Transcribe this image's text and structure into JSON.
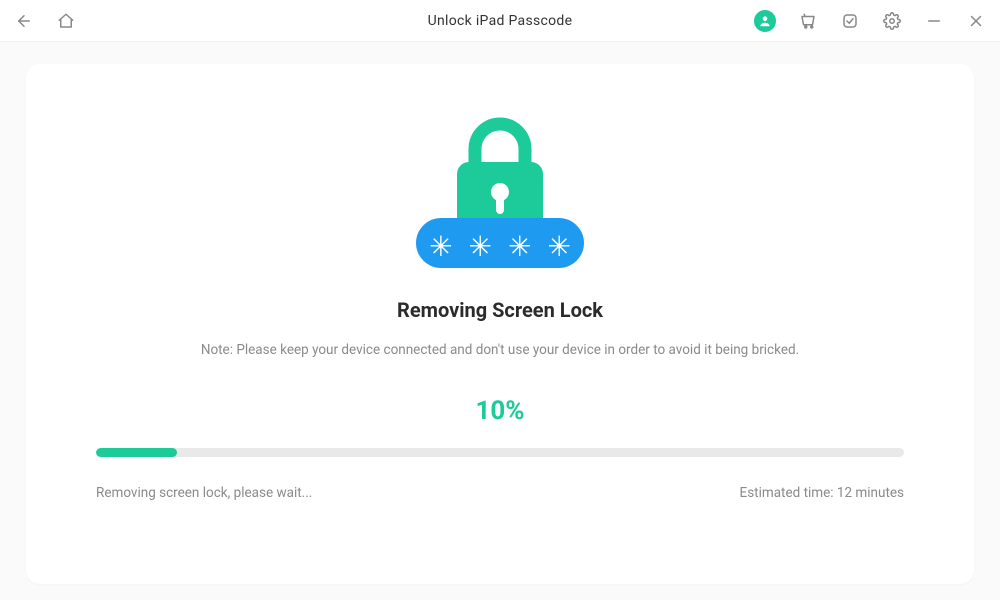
{
  "titlebar": {
    "title": "Unlock iPad Passcode"
  },
  "main": {
    "heading": "Removing Screen Lock",
    "note": "Note: Please keep your device connected and don't use your device in order to avoid it being bricked.",
    "percent_label": "10%",
    "progress_percent": 10,
    "status_left": "Removing screen lock, please wait...",
    "status_right": "Estimated time: 12 minutes"
  },
  "colors": {
    "accent": "#1ccb99",
    "blue": "#1e9bf0"
  }
}
